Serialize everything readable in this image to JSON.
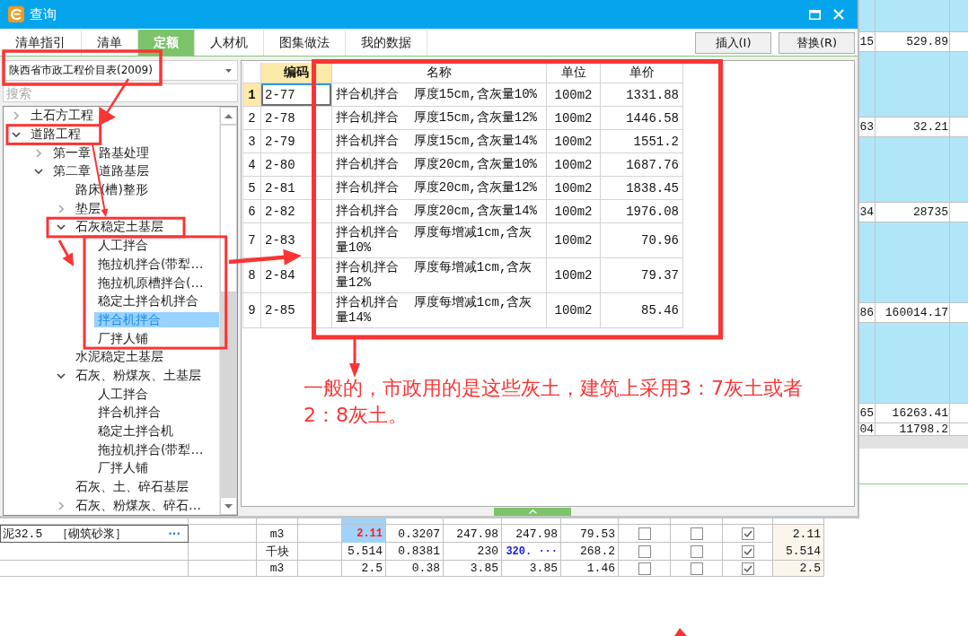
{
  "window": {
    "title": "查询"
  },
  "tabs": [
    {
      "label": "清单指引",
      "selected": false
    },
    {
      "label": "清单",
      "selected": false
    },
    {
      "label": "定额",
      "selected": true
    },
    {
      "label": "人材机",
      "selected": false
    },
    {
      "label": "图集做法",
      "selected": false
    },
    {
      "label": "我的数据",
      "selected": false
    }
  ],
  "actions": [
    "插入(I)",
    "替换(R)"
  ],
  "library_select": {
    "value": "陕西省市政工程价目表(2009)"
  },
  "search": {
    "placeholder": "搜索"
  },
  "tree": [
    {
      "label": "土石方工程",
      "expanded": false,
      "selected": false
    },
    {
      "label": "道路工程",
      "expanded": true,
      "selected": false,
      "children": [
        {
          "label": "第一章  路基处理",
          "expanded": false,
          "selected": false
        },
        {
          "label": "第二章  道路基层",
          "expanded": true,
          "selected": false,
          "children": [
            {
              "label": "路床(槽)整形",
              "selected": false
            },
            {
              "label": "垫层",
              "expanded": false,
              "selected": false
            },
            {
              "label": "石灰稳定土基层",
              "expanded": true,
              "selected": false,
              "children": [
                {
                  "label": "人工拌合",
                  "selected": false
                },
                {
                  "label": "拖拉机拌合(带犁…",
                  "selected": false
                },
                {
                  "label": "拖拉机原槽拌合(…",
                  "selected": false
                },
                {
                  "label": "稳定土拌合机拌合",
                  "selected": false
                },
                {
                  "label": "拌合机拌合",
                  "selected": true
                },
                {
                  "label": "厂拌人铺",
                  "selected": false
                }
              ]
            },
            {
              "label": "水泥稳定土基层",
              "selected": false
            },
            {
              "label": "石灰、粉煤灰、土基层",
              "expanded": true,
              "selected": false,
              "children": [
                {
                  "label": "人工拌合",
                  "selected": false
                },
                {
                  "label": "拌合机拌合",
                  "selected": false
                },
                {
                  "label": "稳定土拌合机",
                  "selected": false
                },
                {
                  "label": "拖拉机拌合(带犁…",
                  "selected": false
                },
                {
                  "label": "厂拌人铺",
                  "selected": false
                }
              ]
            },
            {
              "label": "石灰、土、碎石基层",
              "selected": false
            },
            {
              "label": "石灰、粉煤灰、碎石…",
              "expanded": false,
              "selected": false
            }
          ]
        }
      ]
    }
  ],
  "table": {
    "columns": [
      {
        "label": "编码",
        "selected": true
      },
      {
        "label": "名称",
        "selected": false
      },
      {
        "label": "单位",
        "selected": false
      },
      {
        "label": "单价",
        "selected": false
      }
    ],
    "rows": [
      {
        "number": "1",
        "code": "2-77",
        "name": "拌合机拌合  厚度15cm,含灰量10%",
        "unit": "100m2",
        "price": "1331.88",
        "selected": true
      },
      {
        "number": "2",
        "code": "2-78",
        "name": "拌合机拌合  厚度15cm,含灰量12%",
        "unit": "100m2",
        "price": "1446.58",
        "selected": false
      },
      {
        "number": "3",
        "code": "2-79",
        "name": "拌合机拌合  厚度15cm,含灰量14%",
        "unit": "100m2",
        "price": "1551.2",
        "selected": false
      },
      {
        "number": "4",
        "code": "2-80",
        "name": "拌合机拌合  厚度20cm,含灰量10%",
        "unit": "100m2",
        "price": "1687.76",
        "selected": false
      },
      {
        "number": "5",
        "code": "2-81",
        "name": "拌合机拌合  厚度20cm,含灰量12%",
        "unit": "100m2",
        "price": "1838.45",
        "selected": false
      },
      {
        "number": "6",
        "code": "2-82",
        "name": "拌合机拌合  厚度20cm,含灰量14%",
        "unit": "100m2",
        "price": "1976.08",
        "selected": false
      },
      {
        "number": "7",
        "code": "2-83",
        "name": "拌合机拌合  厚度每增减1cm,含灰量10%",
        "unit": "100m2",
        "price": "70.96",
        "selected": false
      },
      {
        "number": "8",
        "code": "2-84",
        "name": "拌合机拌合  厚度每增减1cm,含灰量12%",
        "unit": "100m2",
        "price": "79.37",
        "selected": false
      },
      {
        "number": "9",
        "code": "2-85",
        "name": "拌合机拌合  厚度每增减1cm,含灰量14%",
        "unit": "100m2",
        "price": "85.46",
        "selected": false
      }
    ]
  },
  "note": "一般的，市政用的是这些灰土，建筑上采用3：7灰土或者2：8灰土。",
  "right_sheet": {
    "rows": [
      {
        "kind": "band"
      },
      {
        "kind": "row",
        "column_1": "15",
        "column_2": "529.89"
      },
      {
        "kind": "band"
      },
      {
        "kind": "row",
        "column_1": "63",
        "column_2": "32.21"
      },
      {
        "kind": "band"
      },
      {
        "kind": "row",
        "column_1": "34",
        "column_2": "28735"
      },
      {
        "kind": "band"
      },
      {
        "kind": "row",
        "column_1": "86",
        "column_2": "160014.17"
      },
      {
        "kind": "band"
      },
      {
        "kind": "row",
        "column_1": "65",
        "column_2": "16263.41"
      },
      {
        "kind": "partial",
        "column_1": "04",
        "column_2": "11798.2"
      }
    ]
  },
  "bottom_sheet": {
    "rows": [
      {
        "kind": "cut",
        "column_5": {
          "selected": true
        }
      },
      {
        "kind": "item",
        "column_1": {
          "text": "泥32.5  ［砌筑砂浆］",
          "button": "···"
        },
        "column_3": "m3",
        "column_5": {
          "text": "2.11",
          "color": "#ff1a1a",
          "selected": true
        },
        "column_6": "0.3207",
        "column_7": "247.98",
        "column_8": "247.98",
        "column_9": "79.53",
        "column_10": {
          "checked": false
        },
        "column_11": {
          "checked": false
        },
        "column_12": {
          "checked": true
        },
        "column_13": "2.11"
      },
      {
        "kind": "item",
        "column_3": "千块",
        "column_5": "5.514",
        "column_6": "0.8381",
        "column_7": "230",
        "column_8": {
          "text": "320. ···",
          "color": "#1a1aee"
        },
        "column_9": "268.2",
        "column_10": {
          "checked": false
        },
        "column_11": {
          "checked": false
        },
        "column_12": {
          "checked": true
        },
        "column_13": "5.514"
      },
      {
        "kind": "item",
        "column_3": "m3",
        "column_5": "2.5",
        "column_6": "0.38",
        "column_7": "3.85",
        "column_8": "3.85",
        "column_9": "1.46",
        "column_10": {
          "checked": false
        },
        "column_11": {
          "checked": false
        },
        "column_12": {
          "checked": true
        },
        "column_13": "2.5"
      }
    ]
  }
}
